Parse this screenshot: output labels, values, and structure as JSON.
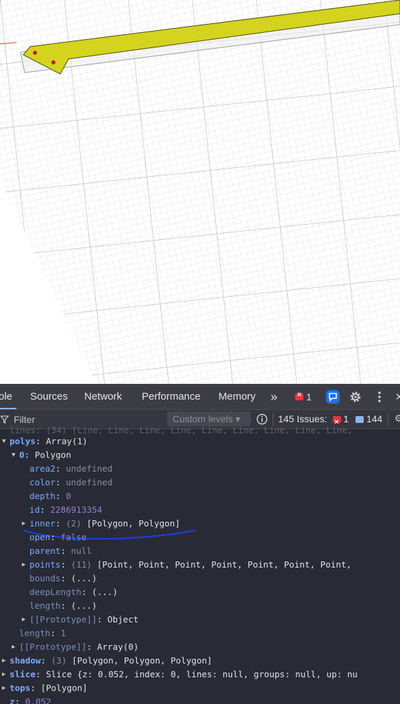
{
  "devtools": {
    "tabs": [
      {
        "label": "ole",
        "active": true
      },
      {
        "label": "Sources"
      },
      {
        "label": "Network"
      },
      {
        "label": "Performance"
      },
      {
        "label": "Memory"
      }
    ],
    "more_tabs": "»",
    "error_count": "1",
    "filter_placeholder": "Filter",
    "custom_levels": "Custom levels ▾",
    "issues_label": "145 Issues:",
    "issues_errors": "1",
    "issues_messages": "144"
  },
  "console": {
    "lines_row": "lines: (34) [Line, Line, Line, Line, Line, Line, Line, Line, Line,",
    "polys_key": "polys",
    "polys_val": "Array(1)",
    "poly0_key": "0",
    "poly0_val": "Polygon",
    "area2_key": "area2",
    "area2_val": "undefined",
    "color_key": "color",
    "color_val": "undefined",
    "depth_key": "depth",
    "depth_val": "0",
    "id_key": "id",
    "id_val": "2286913354",
    "inner_key": "inner",
    "inner_count": "(2)",
    "inner_val": "[Polygon, Polygon]",
    "open_key": "open",
    "open_val": "false",
    "parent_key": "parent",
    "parent_val": "null",
    "points_key": "points",
    "points_count": "(11)",
    "points_val": "[Point, Point, Point, Point, Point, Point, Point,",
    "bounds_key": "bounds",
    "deeplength_key": "deepLength",
    "length_getter_key": "length",
    "getter_val": "(...)",
    "proto_obj_key": "[[Prototype]]",
    "proto_obj_val": "Object",
    "length_key": "length",
    "length_val": "1",
    "proto_arr_key": "[[Prototype]]",
    "proto_arr_val": "Array(0)",
    "shadow_key": "shadow",
    "shadow_count": "(3)",
    "shadow_val": "[Polygon, Polygon, Polygon]",
    "slice_key": "slice",
    "slice_val": "Slice {z: 0.052, index: 0, lines: null, groups: null, up: nu",
    "tops_key": "tops",
    "tops_val": "[Polygon]",
    "z_key": "z",
    "z_val": "0.052"
  },
  "colors": {
    "devtools_bg": "#282a36",
    "key": "#7cacf8",
    "number": "#9a7fd1",
    "accent": "#8ab4f8",
    "error": "#e8363b",
    "shape": "#d4d41e"
  }
}
